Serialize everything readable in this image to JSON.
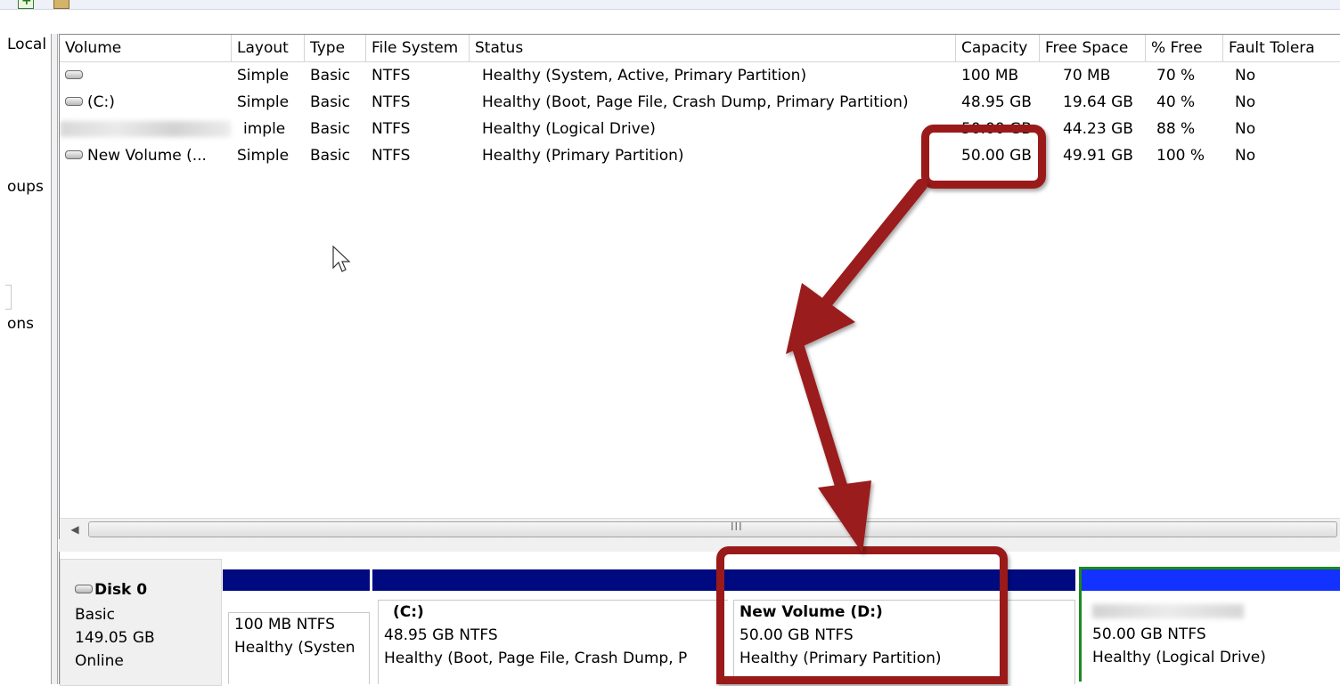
{
  "left_nav": {
    "items": [
      "Local",
      "oups",
      "ons"
    ]
  },
  "columns": [
    "Volume",
    "Layout",
    "Type",
    "File System",
    "Status",
    "Capacity",
    "Free Space",
    "% Free",
    "Fault Tolera"
  ],
  "volumes": [
    {
      "volume": "",
      "layout": "Simple",
      "type": "Basic",
      "fs": "NTFS",
      "status": "Healthy (System, Active, Primary Partition)",
      "capacity": "100 MB",
      "free": "70 MB",
      "pct": "70 %",
      "fault": "No"
    },
    {
      "volume": "(C:)",
      "layout": "Simple",
      "type": "Basic",
      "fs": "NTFS",
      "status": "Healthy (Boot, Page File, Crash Dump, Primary Partition)",
      "capacity": "48.95 GB",
      "free": "19.64 GB",
      "pct": "40 %",
      "fault": "No"
    },
    {
      "volume": "",
      "layout": "imple",
      "type": "Basic",
      "fs": "NTFS",
      "status": "Healthy (Logical Drive)",
      "capacity": "50.00 GB",
      "free": "44.23 GB",
      "pct": "88 %",
      "fault": "No"
    },
    {
      "volume": "New Volume (...",
      "layout": "Simple",
      "type": "Basic",
      "fs": "NTFS",
      "status": "Healthy (Primary Partition)",
      "capacity": "50.00 GB",
      "free": "49.91 GB",
      "pct": "100 %",
      "fault": "No"
    }
  ],
  "scrollbar": {
    "grip": "III"
  },
  "disk": {
    "name": "Disk 0",
    "type": "Basic",
    "size": "149.05 GB",
    "status": "Online"
  },
  "partitions": [
    {
      "title": "",
      "size": "100 MB NTFS",
      "status": "Healthy (Systen",
      "bar_color": "#000a80"
    },
    {
      "title": "(C:)",
      "size": "48.95 GB NTFS",
      "status": "Healthy (Boot, Page File, Crash Dump, P",
      "bar_color": "#000a80"
    },
    {
      "title": "New Volume  (D:)",
      "size": "50.00 GB NTFS",
      "status": "Healthy (Primary Partition)",
      "bar_color": "#000a80"
    },
    {
      "title": "",
      "size": "50.00 GB NTFS",
      "status": "Healthy (Logical Drive)",
      "bar_color": "#1432ff",
      "outline_color": "#1c8a1c"
    }
  ],
  "annotation": {
    "color": "#9a1a1a"
  }
}
